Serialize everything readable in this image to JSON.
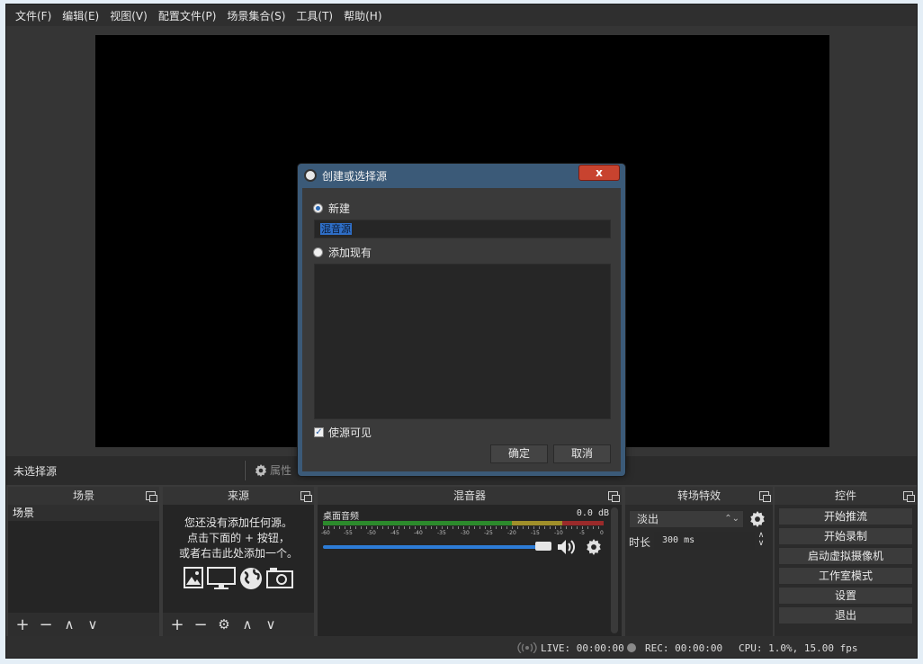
{
  "menu": [
    "文件(F)",
    "编辑(E)",
    "视图(V)",
    "配置文件(P)",
    "场景集合(S)",
    "工具(T)",
    "帮助(H)"
  ],
  "source_bar": {
    "no_source": "未选择源",
    "properties": "属性"
  },
  "docks": {
    "scenes": {
      "title": "场景",
      "items": [
        "场景"
      ]
    },
    "sources": {
      "title": "来源",
      "hint_lines": [
        "您还没有添加任何源。",
        "点击下面的 + 按钮，",
        "或者右击此处添加一个。"
      ]
    },
    "mixer": {
      "title": "混音器",
      "channel": "桌面音频",
      "db": "0.0 dB",
      "ticks": [
        "-60",
        "-55",
        "-50",
        "-45",
        "-40",
        "-35",
        "-30",
        "-25",
        "-20",
        "-15",
        "-10",
        "-5",
        "0"
      ]
    },
    "transitions": {
      "title": "转场特效",
      "selected": "淡出",
      "duration_label": "时长",
      "duration_value": "300 ms"
    },
    "controls": {
      "title": "控件",
      "buttons": [
        "开始推流",
        "开始录制",
        "启动虚拟摄像机",
        "工作室模式",
        "设置",
        "退出"
      ]
    }
  },
  "status": {
    "live": "LIVE: 00:00:00",
    "rec": "REC: 00:00:00",
    "cpu": "CPU: 1.0%, 15.00 fps"
  },
  "dialog": {
    "title": "创建或选择源",
    "close": "x",
    "new_label": "新建",
    "new_value": "混音源",
    "existing_label": "添加现有",
    "visible_label": "使源可见",
    "ok": "确定",
    "cancel": "取消"
  }
}
